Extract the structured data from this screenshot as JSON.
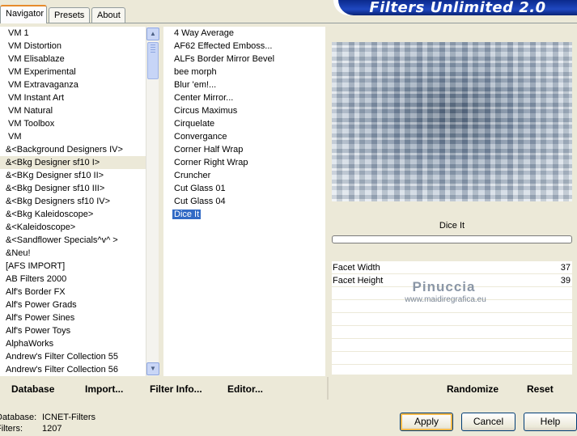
{
  "tabs": [
    {
      "label": "Navigator",
      "active": true
    },
    {
      "label": "Presets",
      "active": false
    },
    {
      "label": "About",
      "active": false
    }
  ],
  "brand_title": "Filters Unlimited 2.0",
  "categories": [
    "VM 1",
    "VM Distortion",
    "VM Elisablaze",
    "VM Experimental",
    "VM Extravaganza",
    "VM Instant Art",
    "VM Natural",
    "VM Toolbox",
    "VM",
    "&<Background Designers IV>",
    "&<Bkg Designer sf10 I>",
    "&<BKg Designer sf10 II>",
    "&<Bkg Designer sf10 III>",
    "&<Bkg Designers sf10 IV>",
    "&<Bkg Kaleidoscope>",
    "&<Kaleidoscope>",
    "&<Sandflower Specials^v^ >",
    "&Neu!",
    "[AFS IMPORT]",
    "AB Filters 2000",
    "Alf's Border FX",
    "Alf's Power Grads",
    "Alf's Power Sines",
    "Alf's Power Toys",
    "AlphaWorks",
    "Andrew's Filter Collection 55",
    "Andrew's Filter Collection 56"
  ],
  "selected_category": "&<Bkg Designer sf10 I>",
  "filters": [
    "4 Way Average",
    "AF62 Effected Emboss...",
    "ALFs Border Mirror Bevel",
    "bee morph",
    "Blur 'em!...",
    "Center Mirror...",
    "Circus Maximus",
    "Cirquelate",
    "Convergance",
    "Corner Half Wrap",
    "Corner Right Wrap",
    "Cruncher",
    "Cut Glass 01",
    "Cut Glass 04",
    "Dice It"
  ],
  "selected_filter": "Dice It",
  "current_filter_title": "Dice It",
  "parameters": [
    {
      "label": "Facet Width",
      "value": "37"
    },
    {
      "label": "Facet Height",
      "value": "39"
    }
  ],
  "watermark": {
    "line1": "Pinuccia",
    "line2": "www.maidiregrafica.eu"
  },
  "links": {
    "database": "Database",
    "import": "Import...",
    "filter_info": "Filter Info...",
    "editor": "Editor...",
    "randomize": "Randomize",
    "reset": "Reset"
  },
  "status": {
    "database_label": "Database:",
    "database_value": "ICNET-Filters",
    "filters_label": "Filters:",
    "filters_value": "1207"
  },
  "buttons": {
    "apply": "Apply",
    "cancel": "Cancel",
    "help": "Help"
  },
  "colors": {
    "selection": "#316ac5",
    "brand_blue": "#1f48c0",
    "tab_highlight": "#e68b2c"
  }
}
